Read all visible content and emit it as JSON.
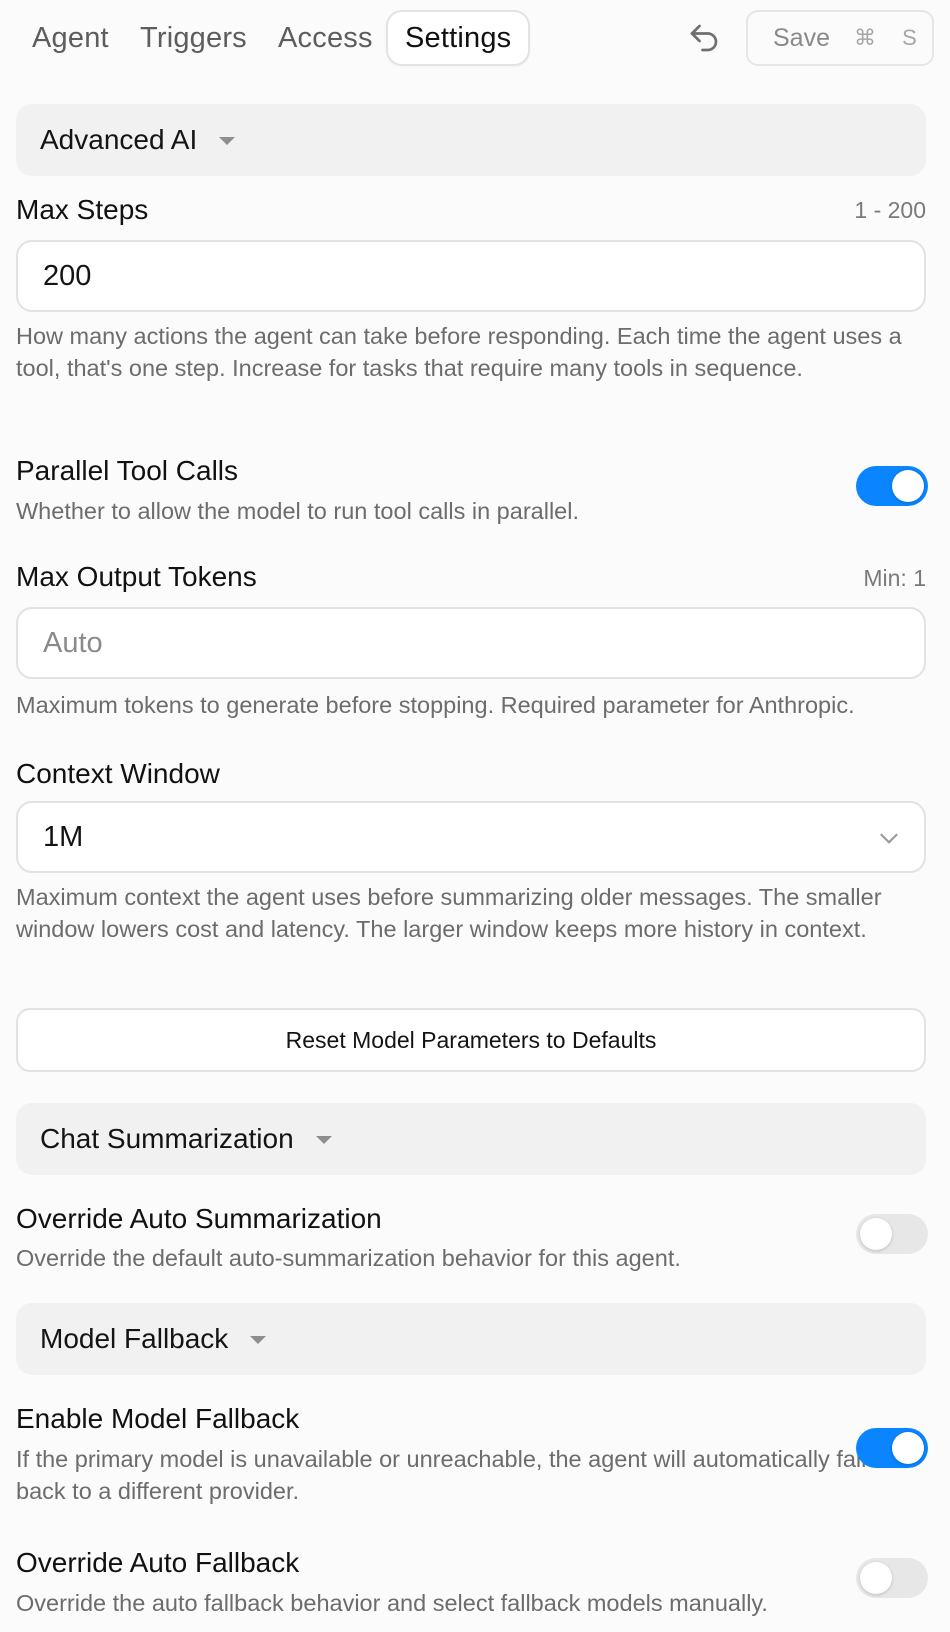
{
  "tabs": [
    {
      "label": "Agent"
    },
    {
      "label": "Triggers"
    },
    {
      "label": "Access"
    },
    {
      "label": "Settings",
      "active": true
    }
  ],
  "toolbar": {
    "undo_icon": "undo-icon",
    "save_label": "Save",
    "save_shortcut": "⌘ S"
  },
  "advanced_ai": {
    "title": "Advanced AI",
    "max_steps": {
      "label": "Max Steps",
      "range": "1 - 200",
      "value": "200",
      "description": "How many actions the agent can take before responding. Each time the agent uses a tool, that's one step. Increase for tasks that require many tools in sequence."
    },
    "parallel_tool_calls": {
      "label": "Parallel Tool Calls",
      "description": "Whether to allow the model to run tool calls in parallel.",
      "enabled": true
    },
    "max_output_tokens": {
      "label": "Max Output Tokens",
      "hint": "Min: 1",
      "value": "",
      "placeholder": "Auto",
      "description": "Maximum tokens to generate before stopping. Required parameter for Anthropic."
    },
    "context_window": {
      "label": "Context Window",
      "value": "1M",
      "description": "Maximum context the agent uses before summarizing older messages. The smaller window lowers cost and latency. The larger window keeps more history in context."
    },
    "reset_label": "Reset Model Parameters to Defaults"
  },
  "chat_summarization": {
    "title": "Chat Summarization",
    "override_auto_summarization": {
      "label": "Override Auto Summarization",
      "description": "Override the default auto-summarization behavior for this agent.",
      "enabled": false
    }
  },
  "model_fallback": {
    "title": "Model Fallback",
    "enable_model_fallback": {
      "label": "Enable Model Fallback",
      "description": "If the primary model is unavailable or unreachable, the agent will automatically fall back to a different provider.",
      "enabled": true
    },
    "override_auto_fallback": {
      "label": "Override Auto Fallback",
      "description": "Override the auto fallback behavior and select fallback models manually.",
      "enabled": false
    }
  },
  "colors": {
    "accent": "#0a84ff",
    "toggle_off": "#e7e7e7",
    "section_bg": "#f1f1f1",
    "page_bg": "#fbfbfb"
  }
}
